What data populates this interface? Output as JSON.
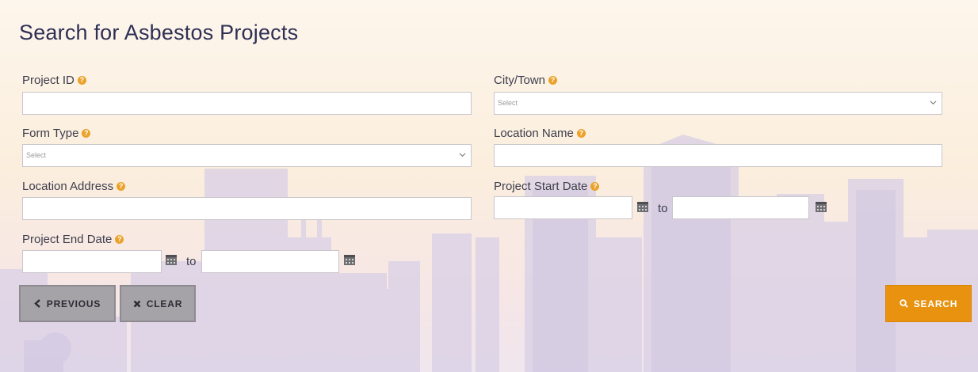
{
  "page": {
    "title": "Search for Asbestos Projects"
  },
  "fields": {
    "project_id": {
      "label": "Project ID",
      "value": ""
    },
    "city_town": {
      "label": "City/Town",
      "selected": "Select"
    },
    "form_type": {
      "label": "Form Type",
      "selected": "Select"
    },
    "location_name": {
      "label": "Location Name",
      "value": ""
    },
    "location_address": {
      "label": "Location Address",
      "value": ""
    },
    "project_start_date": {
      "label": "Project Start Date",
      "from": "",
      "to_text": "to",
      "to": ""
    },
    "project_end_date": {
      "label": "Project End Date",
      "from": "",
      "to_text": "to",
      "to": ""
    }
  },
  "help_icon": "question-circle",
  "buttons": {
    "previous": {
      "label": "PREVIOUS",
      "icon": "chevron-left"
    },
    "clear": {
      "label": "CLEAR",
      "icon": "times"
    },
    "search": {
      "label": "SEARCH",
      "icon": "search"
    }
  },
  "colors": {
    "title": "#2e2f55",
    "accent": "#e8920f",
    "help_icon": "#eba22a",
    "button_grey": "#a5a3a8"
  }
}
